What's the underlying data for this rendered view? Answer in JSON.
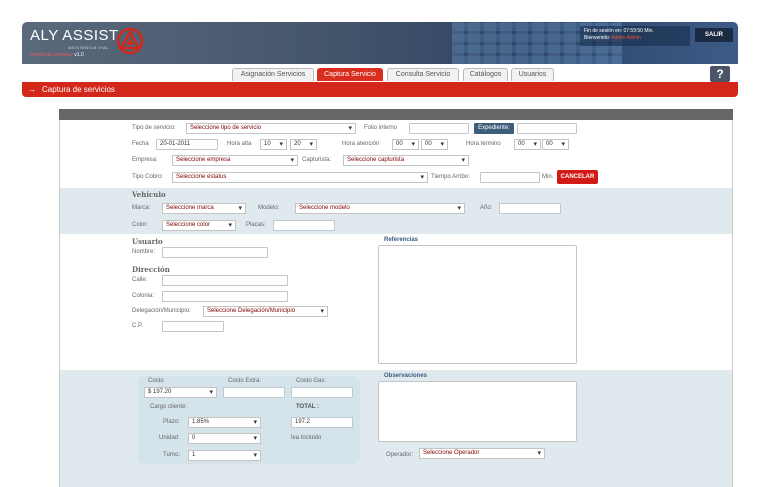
{
  "header": {
    "logo_title": "ALY ASSIST",
    "logo_subtitle": "ASISTENCIA VIAL",
    "logo_tagline": "control de servicios",
    "logo_version": "v1.0",
    "session_label": "Fin de sesión en:",
    "session_time": "07:59:50 Min.",
    "welcome_label": "Bienvenido:",
    "user_name": "Admin Admin",
    "logout_label": "SALIR",
    "accent_color": "#d3271a"
  },
  "tabs": [
    {
      "label": "Asignación Servicios",
      "active": false
    },
    {
      "label": "Captura Servicio",
      "active": true
    },
    {
      "label": "Consulta Servicio",
      "active": false
    },
    {
      "label": "Catálogos",
      "active": false
    },
    {
      "label": "Usuarios",
      "active": false
    }
  ],
  "help_label": "?",
  "page_title": "Captura de servicios",
  "servicio": {
    "tipo_label": "Tipo de servicio:",
    "tipo_value": "Seleccione tipo de servicio",
    "folio_label": "Folio interno",
    "folio_value": "",
    "expediente_label": "Expediente:",
    "expediente_value": "",
    "fecha_label": "Fecha",
    "fecha_value": "20-01-2011",
    "hora_alta_label": "Hora alta",
    "hora_alta_h": "10",
    "hora_alta_m": "20",
    "hora_atencion_label": "Hora atención",
    "hora_atencion_h": "00",
    "hora_atencion_m": "00",
    "hora_termino_label": "Hora termino",
    "hora_termino_h": "00",
    "hora_termino_m": "00",
    "empresa_label": "Empresa:",
    "empresa_value": "Seleccione empresa",
    "capturista_label": "Capturista:",
    "capturista_value": "Seleccione capturista",
    "cobro_label": "Tipo Cobro:",
    "cobro_value": "Seleccione estatus",
    "arribo_label": "Tiempo Arribo:",
    "arribo_value": "",
    "arribo_unit": "Min.",
    "cancel_label": "CANCELAR"
  },
  "vehiculo": {
    "title": "Vehículo",
    "marca_label": "Marca:",
    "marca_value": "Seleccione marca",
    "modelo_label": "Modelo:",
    "modelo_value": "Seleccione modelo",
    "anio_label": "Año:",
    "anio_value": "",
    "color_label": "Color:",
    "color_value": "Seleccione color",
    "placas_label": "Placas:",
    "placas_value": ""
  },
  "usuario": {
    "title": "Usuario",
    "nombre_label": "Nombre:",
    "nombre_value": "",
    "direccion_title": "Dirección",
    "calle_label": "Calle:",
    "calle_value": "",
    "colonia_label": "Colonia:",
    "colonia_value": "",
    "delegacion_label": "Delegación/Municipio:",
    "delegacion_value": "Seleccione Delegación/Municipio",
    "cp_label": "C.P.",
    "cp_value": "",
    "referencias_title": "Referencias"
  },
  "costos": {
    "costo_label": "Costo",
    "costo_value": "$ 197.20",
    "costo_extra_label": "Costo Extra:",
    "costo_extra_value": "",
    "costo_gas_label": "Costo Gas:",
    "costo_gas_value": "",
    "cargo_label": "Cargo cliente:",
    "total_label": "TOTAL :",
    "total_value": "197.2",
    "plazo_label": "Plazo:",
    "plazo_value": "1.85%",
    "iva_label": "Iva Incluido",
    "unidad_label": "Unidad:",
    "unidad_value": "0",
    "turno_label": "Turno:",
    "turno_value": "1",
    "observaciones_title": "Observaciones",
    "operador_label": "Operador:",
    "operador_value": "Seleccione Operador"
  }
}
